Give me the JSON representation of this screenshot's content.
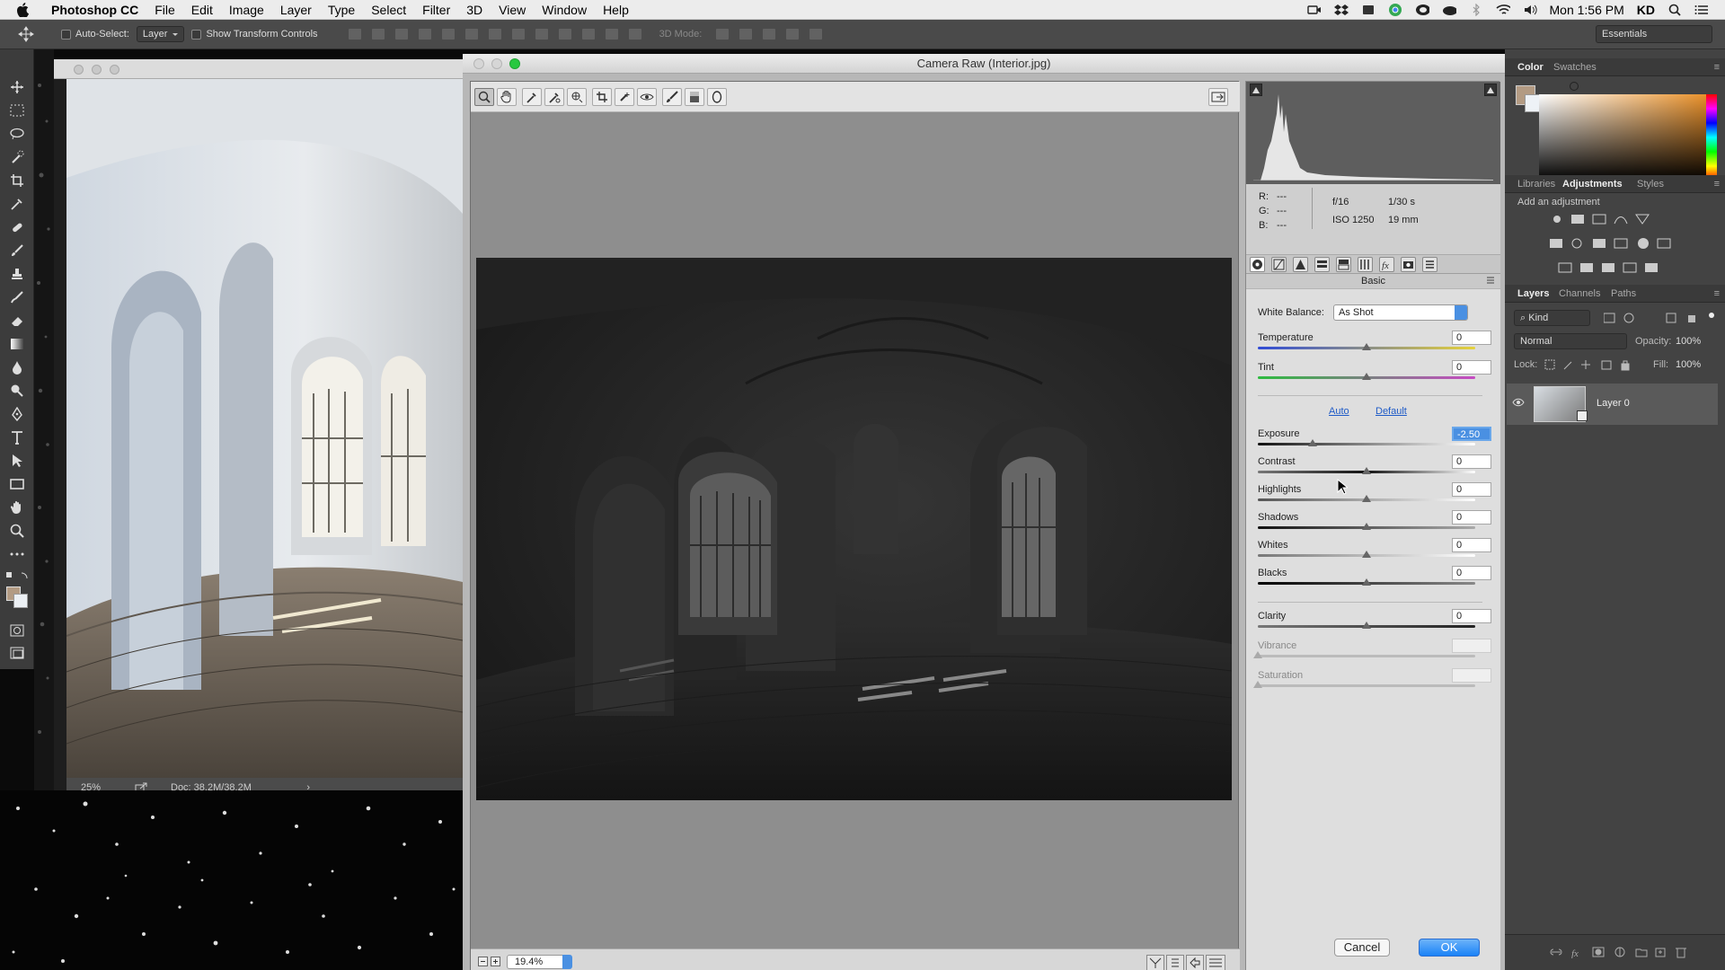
{
  "menubar": {
    "app_name": "Photoshop CC",
    "items": [
      "File",
      "Edit",
      "Image",
      "Layer",
      "Type",
      "Select",
      "Filter",
      "3D",
      "View",
      "Window",
      "Help"
    ],
    "clock": "Mon 1:56 PM",
    "user": "KD"
  },
  "options_bar": {
    "auto_select_label": "Auto-Select:",
    "auto_select_value": "Layer",
    "transform_label": "Show Transform Controls",
    "mode_3d_label": "3D Mode:",
    "workspace": "Essentials"
  },
  "document": {
    "zoom": "25%",
    "doc_size": "Doc: 38.2M/38.2M"
  },
  "camera_raw": {
    "title": "Camera Raw (Interior.jpg)",
    "zoom_value": "19.4%",
    "info": {
      "r_label": "R:",
      "r_value": "---",
      "g_label": "G:",
      "g_value": "---",
      "b_label": "B:",
      "b_value": "---",
      "aperture": "f/16",
      "shutter": "1/30 s",
      "iso": "ISO 1250",
      "focal": "19 mm"
    },
    "panel_title": "Basic",
    "white_balance_label": "White Balance:",
    "white_balance_value": "As Shot",
    "auto_link": "Auto",
    "default_link": "Default",
    "sliders": [
      {
        "label": "Temperature",
        "value": "0"
      },
      {
        "label": "Tint",
        "value": "0"
      },
      {
        "label": "Exposure",
        "value": "-2.50"
      },
      {
        "label": "Contrast",
        "value": "0"
      },
      {
        "label": "Highlights",
        "value": "0"
      },
      {
        "label": "Shadows",
        "value": "0"
      },
      {
        "label": "Whites",
        "value": "0"
      },
      {
        "label": "Blacks",
        "value": "0"
      },
      {
        "label": "Clarity",
        "value": "0"
      },
      {
        "label": "Vibrance",
        "value": ""
      },
      {
        "label": "Saturation",
        "value": ""
      }
    ],
    "cancel_label": "Cancel",
    "ok_label": "OK"
  },
  "panels": {
    "color_tabs": [
      "Color",
      "Swatches"
    ],
    "adj_tabs": [
      "Libraries",
      "Adjustments",
      "Styles"
    ],
    "add_adjustment": "Add an adjustment",
    "layer_tabs": [
      "Layers",
      "Channels",
      "Paths"
    ],
    "kind_label": "Kind",
    "blend_mode": "Normal",
    "opacity_label": "Opacity:",
    "opacity_value": "100%",
    "lock_label": "Lock:",
    "fill_label": "Fill:",
    "fill_value": "100%",
    "layer_name": "Layer 0"
  },
  "colors": {
    "accent": "#4a90e2",
    "close_red": "#ff5f57",
    "zoom_green": "#28c840",
    "link_blue": "#1f5bc7"
  }
}
